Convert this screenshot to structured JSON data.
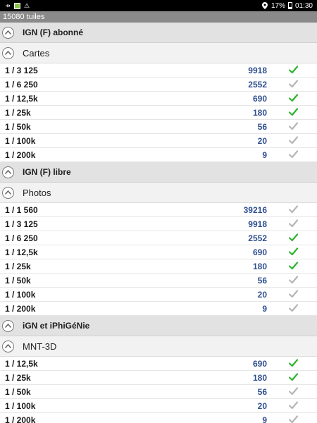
{
  "status_bar": {
    "battery": "17%",
    "time": "01:30",
    "icons": [
      "usb-icon",
      "map-app-icon",
      "warning-icon",
      "location-icon",
      "battery-icon"
    ]
  },
  "title": "15080 tuiles",
  "colors": {
    "checked": "#2db32d",
    "unchecked": "#b5b5b5",
    "count": "#2f4f8f"
  },
  "sections": [
    {
      "title": "IGN (F) abonné",
      "subtitle": "Cartes",
      "rows": [
        {
          "scale": "1 / 3 125",
          "count": "9918",
          "checked": true
        },
        {
          "scale": "1 / 6 250",
          "count": "2552",
          "checked": false
        },
        {
          "scale": "1 / 12,5k",
          "count": "690",
          "checked": true
        },
        {
          "scale": "1 / 25k",
          "count": "180",
          "checked": true
        },
        {
          "scale": "1 / 50k",
          "count": "56",
          "checked": false
        },
        {
          "scale": "1 / 100k",
          "count": "20",
          "checked": false
        },
        {
          "scale": "1 / 200k",
          "count": "9",
          "checked": false
        }
      ]
    },
    {
      "title": "IGN (F) libre",
      "subtitle": "Photos",
      "rows": [
        {
          "scale": "1 / 1 560",
          "count": "39216",
          "checked": false
        },
        {
          "scale": "1 / 3 125",
          "count": "9918",
          "checked": false
        },
        {
          "scale": "1 / 6 250",
          "count": "2552",
          "checked": true
        },
        {
          "scale": "1 / 12,5k",
          "count": "690",
          "checked": true
        },
        {
          "scale": "1 / 25k",
          "count": "180",
          "checked": true
        },
        {
          "scale": "1 / 50k",
          "count": "56",
          "checked": false
        },
        {
          "scale": "1 / 100k",
          "count": "20",
          "checked": false
        },
        {
          "scale": "1 / 200k",
          "count": "9",
          "checked": false
        }
      ]
    },
    {
      "title": "iGN et iPhiGéNie",
      "subtitle": "MNT-3D",
      "rows": [
        {
          "scale": "1 / 12,5k",
          "count": "690",
          "checked": true
        },
        {
          "scale": "1 / 25k",
          "count": "180",
          "checked": true
        },
        {
          "scale": "1 / 50k",
          "count": "56",
          "checked": false
        },
        {
          "scale": "1 / 100k",
          "count": "20",
          "checked": false
        },
        {
          "scale": "1 / 200k",
          "count": "9",
          "checked": false
        }
      ]
    }
  ]
}
